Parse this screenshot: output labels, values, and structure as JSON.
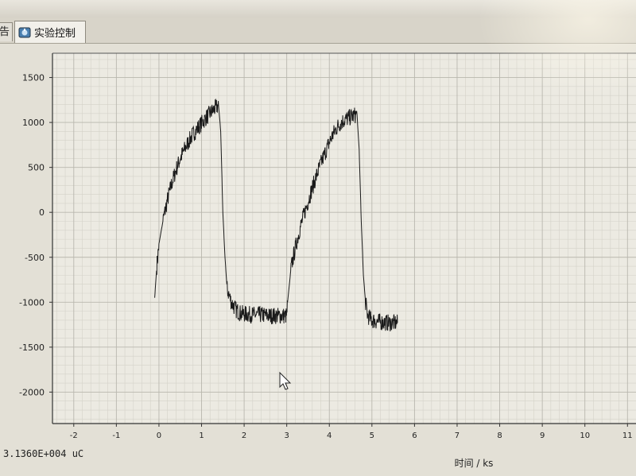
{
  "tabs": [
    {
      "label": "告",
      "active": false
    },
    {
      "label": "实验控制",
      "active": true
    }
  ],
  "status_readout": "3.1360E+004  uC",
  "chart_data": {
    "type": "line",
    "title": "",
    "xlabel": "时间  / ks",
    "ylabel": "",
    "xlim": [
      -2.5,
      11.2
    ],
    "ylim": [
      -2350,
      1770
    ],
    "x_ticks": [
      -2,
      -1,
      0,
      1,
      2,
      3,
      4,
      5,
      6,
      7,
      8,
      9,
      10,
      11
    ],
    "y_ticks": [
      1500,
      1000,
      500,
      0,
      -500,
      -1000,
      -1500,
      -2000
    ],
    "grid": true,
    "line_color": "#1a1a1a",
    "series": [
      {
        "x": [
          -0.1,
          -0.05,
          0.0,
          0.1,
          0.2,
          0.3,
          0.4,
          0.5,
          0.6,
          0.7,
          0.8,
          0.9,
          1.0,
          1.1,
          1.2,
          1.3,
          1.35,
          1.4,
          1.45,
          1.5,
          1.55,
          1.6,
          1.7,
          1.8,
          1.9,
          2.0,
          2.2,
          2.4,
          2.6,
          2.8,
          3.0,
          3.02,
          3.1,
          3.2,
          3.3,
          3.4,
          3.5,
          3.6,
          3.7,
          3.8,
          3.9,
          4.0,
          4.1,
          4.2,
          4.3,
          4.4,
          4.5,
          4.6,
          4.65,
          4.7,
          4.75,
          4.8,
          4.85,
          4.9,
          5.0,
          5.2,
          5.4,
          5.6
        ],
        "y": [
          -950,
          -600,
          -350,
          -80,
          140,
          320,
          470,
          600,
          700,
          790,
          870,
          930,
          990,
          1050,
          1100,
          1150,
          1170,
          1190,
          900,
          0,
          -500,
          -850,
          -1000,
          -1080,
          -1120,
          -1130,
          -1140,
          -1140,
          -1150,
          -1150,
          -1150,
          -1000,
          -620,
          -400,
          -200,
          -30,
          120,
          270,
          410,
          540,
          660,
          780,
          880,
          960,
          1010,
          1040,
          1060,
          1080,
          1090,
          700,
          -100,
          -700,
          -1000,
          -1150,
          -1200,
          -1220,
          -1230,
          -1230
        ]
      }
    ]
  }
}
